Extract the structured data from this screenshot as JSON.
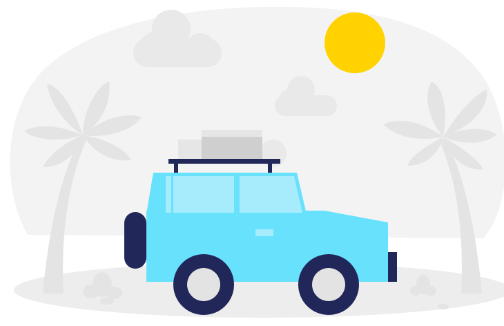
{
  "palette": {
    "background_blob": "#f3f3f3",
    "cloud": "#e9e9e9",
    "palm": "#e4e4e4",
    "ground": "#ededed",
    "sun": "#ffd200",
    "car_body": "#68e1fd",
    "car_window": "#a7ecfd",
    "car_dark": "#212759",
    "tire_hub": "#e3e3e3",
    "luggage_light": "#e6e6e6",
    "luggage_dark": "#cfcfcf"
  },
  "illustration": {
    "elements": [
      "sun",
      "clouds",
      "palm-trees",
      "jeep",
      "roof-luggage",
      "ground-shrubs"
    ]
  }
}
